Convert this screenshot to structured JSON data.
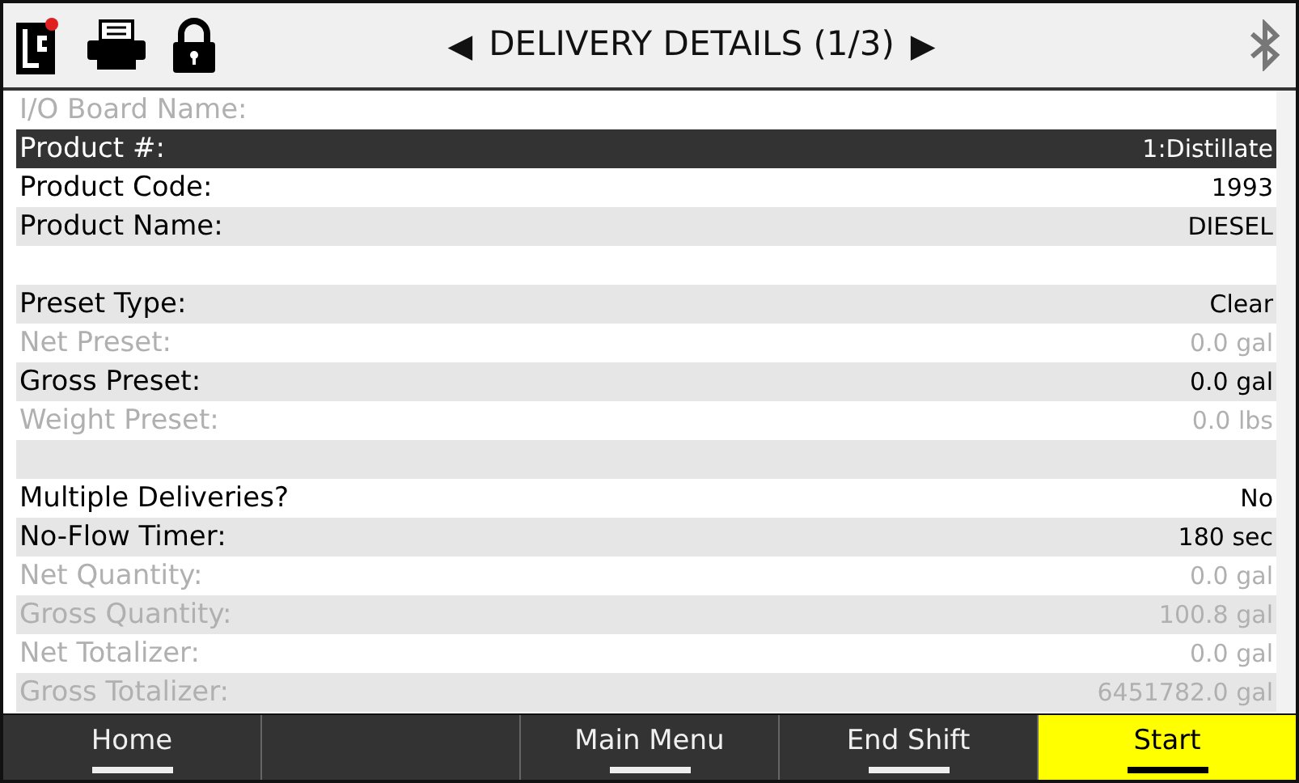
{
  "header": {
    "title": "DELIVERY DETAILS (1/3)",
    "prev": "◀",
    "next": "▶"
  },
  "sections": [
    {
      "rows": [
        {
          "label": "I/O Board Name:",
          "disabled": true,
          "selected": false
        },
        {
          "label": "Product #:",
          "value": "1:Distillate",
          "disabled": false,
          "selected": true
        },
        {
          "label": "Product Code:",
          "value": "1993",
          "disabled": false,
          "selected": false
        },
        {
          "label": "Product Name:",
          "value": "DIESEL",
          "disabled": false,
          "selected": false
        }
      ]
    },
    {
      "rows": [
        {
          "label": "Preset Type:",
          "value": "Clear",
          "disabled": false,
          "selected": false
        },
        {
          "label": "Net Preset:",
          "value": "0.0 gal",
          "disabled": true,
          "selected": false
        },
        {
          "label": "Gross Preset:",
          "value": "0.0 gal",
          "disabled": false,
          "selected": false
        },
        {
          "label": "Weight Preset:",
          "value": "0.0 lbs",
          "disabled": true,
          "selected": false
        }
      ]
    },
    {
      "rows": [
        {
          "label": "Multiple Deliveries?",
          "value": "No",
          "disabled": false,
          "selected": false
        },
        {
          "label": "No-Flow Timer:",
          "value": "180 sec",
          "disabled": false,
          "selected": false
        },
        {
          "label": "Net Quantity:",
          "value": "0.0 gal",
          "disabled": true,
          "selected": false
        },
        {
          "label": "Gross Quantity:",
          "value": "100.8 gal",
          "disabled": true,
          "selected": false
        },
        {
          "label": "Net Totalizer:",
          "value": "0.0 gal",
          "disabled": true,
          "selected": false
        },
        {
          "label": "Gross Totalizer:",
          "value": "6451782.0 gal",
          "disabled": true,
          "selected": false
        }
      ]
    }
  ],
  "softkeys": [
    {
      "label": "Home",
      "highlighted": false
    },
    {
      "highlighted": false
    },
    {
      "label": "Main Menu",
      "highlighted": false
    },
    {
      "label": "End Shift",
      "highlighted": false
    },
    {
      "label": "Start",
      "highlighted": true
    }
  ]
}
